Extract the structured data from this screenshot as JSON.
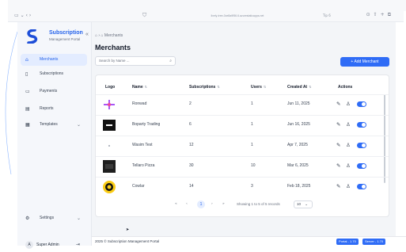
{
  "browser": {
    "address": "lively-tree-0ce8a9f56.6.azurestaticapps.net",
    "tab_label": "Tip 6"
  },
  "sidebar": {
    "brand_title": "Subscription",
    "brand_subtitle": "Management Portal",
    "items": [
      {
        "label": "Merchants",
        "icon": "store-icon",
        "active": true
      },
      {
        "label": "Subscriptions",
        "icon": "document-icon",
        "active": false
      },
      {
        "label": "Payments",
        "icon": "card-icon",
        "active": false
      },
      {
        "label": "Reports",
        "icon": "report-icon",
        "active": false
      },
      {
        "label": "Templates",
        "icon": "template-icon",
        "active": false
      }
    ],
    "settings": {
      "label": "Settings",
      "icon": "gear-icon"
    },
    "user": {
      "name": "Super Admin",
      "initials": "A"
    }
  },
  "main": {
    "breadcrumb_current": "Merchants",
    "title": "Merchants",
    "search_placeholder": "Search by Name ...",
    "add_button": "+ Add Merchant",
    "columns": [
      "Logo",
      "Name",
      "Subscriptions",
      "Users",
      "Created At",
      "Actions"
    ],
    "rows": [
      {
        "name": "Ronwad",
        "subscriptions": "2",
        "users": "1",
        "created": "Jun 11, 2025",
        "logo": "ronwad"
      },
      {
        "name": "Boparty Trading",
        "subscriptions": "6",
        "users": "1",
        "created": "Jun 16, 2025",
        "logo": "black"
      },
      {
        "name": "Wasim Test",
        "subscriptions": "12",
        "users": "1",
        "created": "Apr 7, 2025",
        "logo": "dot"
      },
      {
        "name": "Tellaro Pizza",
        "subscriptions": "30",
        "users": "10",
        "created": "Mar 6, 2025",
        "logo": "dark"
      },
      {
        "name": "Cowlar",
        "subscriptions": "14",
        "users": "3",
        "created": "Feb 18, 2025",
        "logo": "cowlar"
      }
    ],
    "pager": {
      "current": "1",
      "info": "Showing 1 to 5 of 5 records",
      "per_page": "10"
    }
  },
  "footer": {
    "copyright": "2025 © Subscription Management Portal",
    "portal_version": "Portal - 1.70",
    "server_version": "Server - 1.70"
  },
  "colors": {
    "accent": "#2f6cf6",
    "active_bg": "#e3ecff"
  }
}
